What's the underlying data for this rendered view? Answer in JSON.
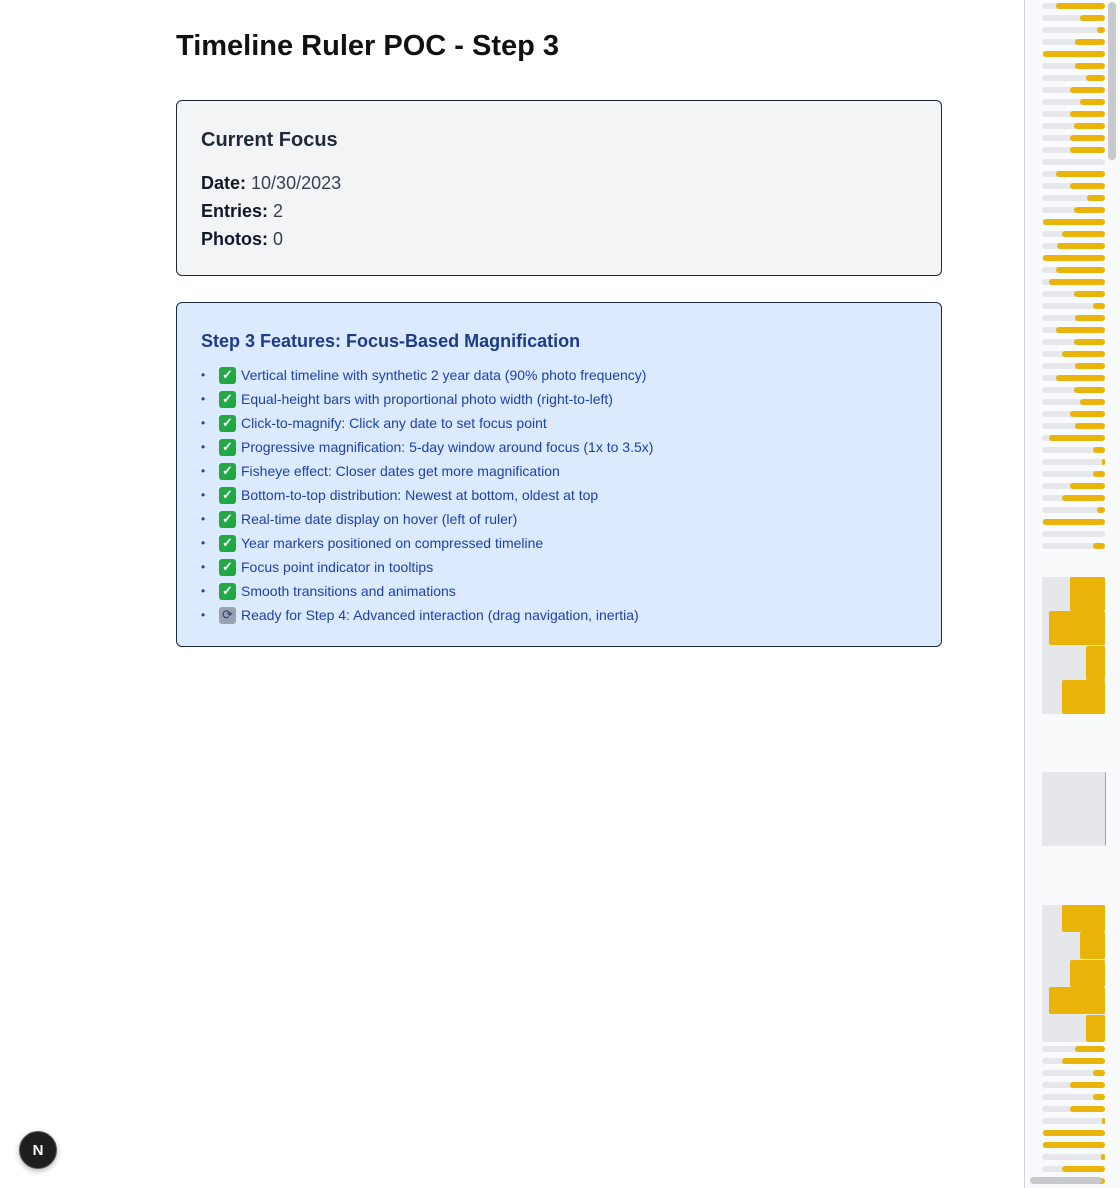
{
  "page": {
    "title": "Timeline Ruler POC - Step 3"
  },
  "focus": {
    "heading": "Current Focus",
    "date_label": "Date:",
    "date_value": "10/30/2023",
    "entries_label": "Entries:",
    "entries_value": "2",
    "photos_label": "Photos:",
    "photos_value": "0"
  },
  "features": {
    "heading": "Step 3 Features: Focus-Based Magnification",
    "items": [
      {
        "icon": "check-icon",
        "text": "Vertical timeline with synthetic 2 year data (90% photo frequency)"
      },
      {
        "icon": "check-icon",
        "text": "Equal-height bars with proportional photo width (right-to-left)"
      },
      {
        "icon": "check-icon",
        "text": "Click-to-magnify: Click any date to set focus point"
      },
      {
        "icon": "check-icon",
        "text": "Progressive magnification: 5-day window around focus (1x to 3.5x)"
      },
      {
        "icon": "check-icon",
        "text": "Fisheye effect: Closer dates get more magnification"
      },
      {
        "icon": "check-icon",
        "text": "Bottom-to-top distribution: Newest at bottom, oldest at top"
      },
      {
        "icon": "check-icon",
        "text": "Real-time date display on hover (left of ruler)"
      },
      {
        "icon": "check-icon",
        "text": "Year markers positioned on compressed timeline"
      },
      {
        "icon": "check-icon",
        "text": "Focus point indicator in tooltips"
      },
      {
        "icon": "check-icon",
        "text": "Smooth transitions and animations"
      },
      {
        "icon": "refresh-icon",
        "text": "Ready for Step 4: Advanced interaction (drag navigation, inertia)"
      }
    ]
  },
  "badge": {
    "label": "N"
  },
  "colors": {
    "bar": "#eab308",
    "track": "#e5e7eb",
    "panel_blue": "#dbeafe",
    "panel_gray": "#f3f4f6"
  },
  "ruler": {
    "photo_fractions_top": [
      0.78,
      0.4,
      0.13,
      0.48,
      0.98,
      0.48,
      0.3,
      0.56,
      0.4,
      0.56,
      0.49,
      0.56,
      0.56,
      0,
      0.78,
      0.56,
      0.28,
      0.49,
      0.98,
      0.69,
      0.76,
      0.98,
      0.78,
      0.89,
      0.49,
      0.19,
      0.48,
      0.78,
      0.49,
      0.69,
      0.48,
      0.78,
      0.49,
      0.4,
      0.56,
      0.48,
      0.89,
      0.19,
      0.05,
      0.19,
      0.56,
      0.69,
      0.13,
      0.98,
      0,
      0.19
    ],
    "focus_block_top": [
      0.56,
      0.89,
      0.3,
      0.69
    ],
    "focus_block_bottom": [
      0.69,
      0.4,
      0.56,
      0.89,
      0.3
    ],
    "photo_fractions_bottom": [
      0.48,
      0.69,
      0.19,
      0.56,
      0.19,
      0.56,
      0.05,
      0.98,
      0.98,
      0.06,
      0.69,
      0.89
    ]
  }
}
